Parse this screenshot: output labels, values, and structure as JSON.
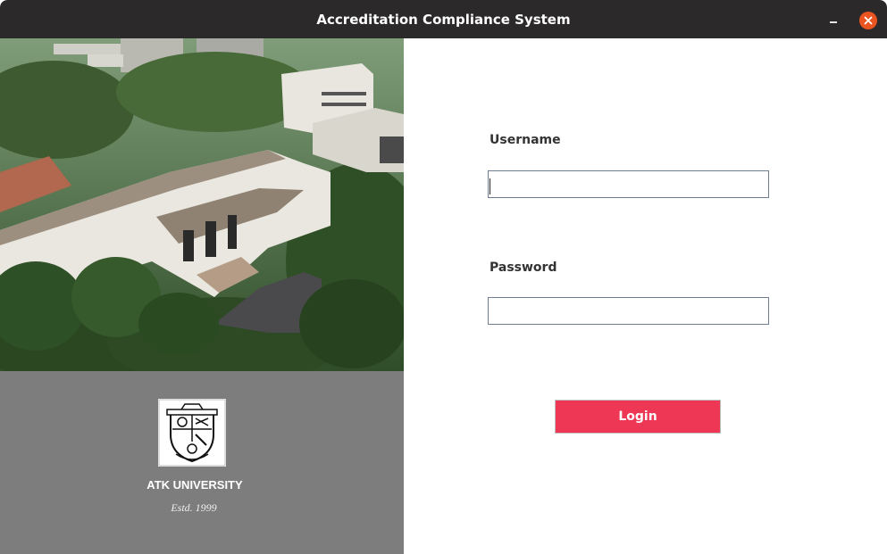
{
  "window": {
    "title": "Accreditation Compliance System"
  },
  "branding": {
    "university_name": "ATK UNIVERSITY",
    "established": "Estd. 1999",
    "crest_icon": "university-crest-icon",
    "photo": "campus-aerial-photo"
  },
  "form": {
    "username_label": "Username",
    "username_value": "",
    "password_label": "Password",
    "password_value": "",
    "login_label": "Login"
  },
  "colors": {
    "titlebar": "#2b2929",
    "close_button": "#e95420",
    "left_panel": "#7d7d7d",
    "login_button": "#ee3754"
  }
}
